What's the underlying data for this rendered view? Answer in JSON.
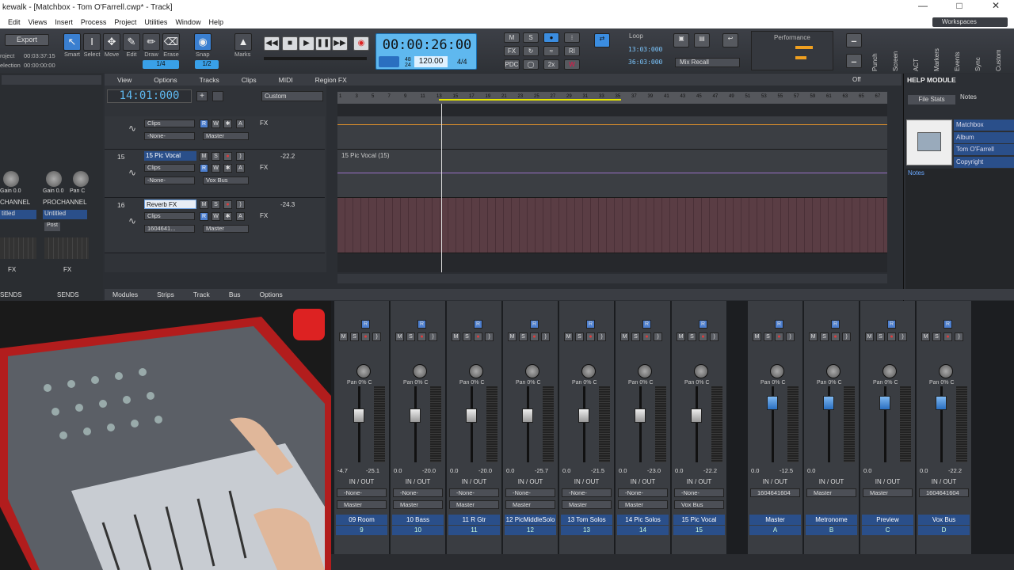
{
  "window": {
    "title": "kewalk - [Matchbox - Tom O'Farrell.cwp* - Track]"
  },
  "menu": [
    "Edit",
    "Views",
    "Insert",
    "Process",
    "Project",
    "Utilities",
    "Window",
    "Help"
  ],
  "workspaces": "Workspaces",
  "controlbar": {
    "export": "Export",
    "project_lbl": "roject",
    "project_time": "00:03:37:15",
    "selection_lbl": "election",
    "selection_time": "00:00:00:00",
    "tools": [
      "Smart",
      "Select",
      "Move",
      "Edit",
      "Draw",
      "Erase"
    ],
    "snap": "Snap",
    "marks": "Marks",
    "snap_value": "1/4",
    "marks_value": "1/2",
    "time": "00:00:26:00",
    "sig_top": "48",
    "sig_bot": "24",
    "tempo": "120.00",
    "meter": "4/4",
    "loop_label": "Loop",
    "loop_start": "13:03:000",
    "loop_end": "36:03:000",
    "mix_recall": "Mix Recall",
    "performance": "Performance",
    "vertical_tabs": [
      "Punch",
      "Screen",
      "ACT",
      "Markers",
      "Events",
      "Sync",
      "Custom"
    ],
    "small_btns": [
      "M",
      "S",
      "FX",
      "R",
      "PDC",
      "2x",
      "W",
      "RI"
    ]
  },
  "trackview": {
    "menus": [
      "View",
      "Options",
      "Tracks",
      "Clips",
      "MIDI",
      "Region FX"
    ],
    "position": "14:01:000",
    "preset": "Custom",
    "fx_off": "Off",
    "ruler": [
      "1",
      "3",
      "5",
      "7",
      "9",
      "11",
      "13",
      "15",
      "17",
      "19",
      "21",
      "23",
      "25",
      "27",
      "29",
      "31",
      "33",
      "35",
      "37",
      "39",
      "41",
      "43",
      "45",
      "47",
      "49",
      "51",
      "53",
      "55",
      "57",
      "59",
      "61",
      "63",
      "65",
      "67"
    ],
    "tracks": [
      {
        "num": "",
        "name": "",
        "clips": "Clips",
        "in": "-None-",
        "out": "Master",
        "vol": ""
      },
      {
        "num": "15",
        "name": "15 Pic Vocal",
        "clips": "Clips",
        "in": "-None-",
        "out": "Vox Bus",
        "vol": "-22.2"
      },
      {
        "num": "16",
        "name": "Reverb FX",
        "clips": "Clips",
        "in": "1604641...",
        "out": "Master",
        "vol": "-24.3"
      }
    ],
    "clip_label": "15 Pic Vocal (15)",
    "fx": "FX"
  },
  "leftstrips": {
    "gain1": "Gain 0.0",
    "gain2": "Gain 0.0",
    "pan": "Pan C",
    "chan1": "CHANNEL",
    "chan2": "PROCHANNEL",
    "title1": "titled",
    "title2": "Untitled",
    "post": "Post",
    "fx": "FX",
    "sends": "SENDS"
  },
  "help": {
    "title": "HELP MODULE",
    "notes_tab": "Notes",
    "file_stats": "File Stats",
    "fields": [
      "Matchbox",
      "Album",
      "Tom O'Farrell",
      "Copyright"
    ],
    "notes": "Notes"
  },
  "console": {
    "menus": [
      "Modules",
      "Strips",
      "Track",
      "Bus",
      "Options"
    ],
    "io": "IN / OUT",
    "pan": "Pan 0% C",
    "strips": [
      {
        "name": "09 Room",
        "num": "9",
        "in": "-None-",
        "out": "Master",
        "v1": "-4.7",
        "v2": "-25.1",
        "bus": false
      },
      {
        "name": "10 Bass",
        "num": "10",
        "in": "-None-",
        "out": "Master",
        "v1": "0.0",
        "v2": "-20.0",
        "bus": false
      },
      {
        "name": "11 R Gtr",
        "num": "11",
        "in": "-None-",
        "out": "Master",
        "v1": "0.0",
        "v2": "-20.0",
        "bus": false
      },
      {
        "name": "12 PicMiddleSolo",
        "num": "12",
        "in": "-None-",
        "out": "Master",
        "v1": "0.0",
        "v2": "-25.7",
        "bus": false
      },
      {
        "name": "13 Tom Solos",
        "num": "13",
        "in": "-None-",
        "out": "Master",
        "v1": "0.0",
        "v2": "-21.5",
        "bus": false
      },
      {
        "name": "14 Pic Solos",
        "num": "14",
        "in": "-None-",
        "out": "Master",
        "v1": "0.0",
        "v2": "-23.0",
        "bus": false
      },
      {
        "name": "15 Pic Vocal",
        "num": "15",
        "in": "-None-",
        "out": "Vox Bus",
        "v1": "0.0",
        "v2": "-22.2",
        "bus": false
      },
      {
        "name": "Master",
        "num": "A",
        "in": "1604641604",
        "out": "",
        "v1": "0.0",
        "v2": "-12.5",
        "bus": true
      },
      {
        "name": "Metronome",
        "num": "B",
        "in": "Master",
        "out": "",
        "v1": "0.0",
        "v2": "",
        "bus": true
      },
      {
        "name": "Preview",
        "num": "C",
        "in": "Master",
        "out": "",
        "v1": "0.0",
        "v2": "",
        "bus": true
      },
      {
        "name": "Vox Bus",
        "num": "D",
        "in": "1604641604",
        "out": "",
        "v1": "0.0",
        "v2": "-22.2",
        "bus": true
      }
    ]
  }
}
